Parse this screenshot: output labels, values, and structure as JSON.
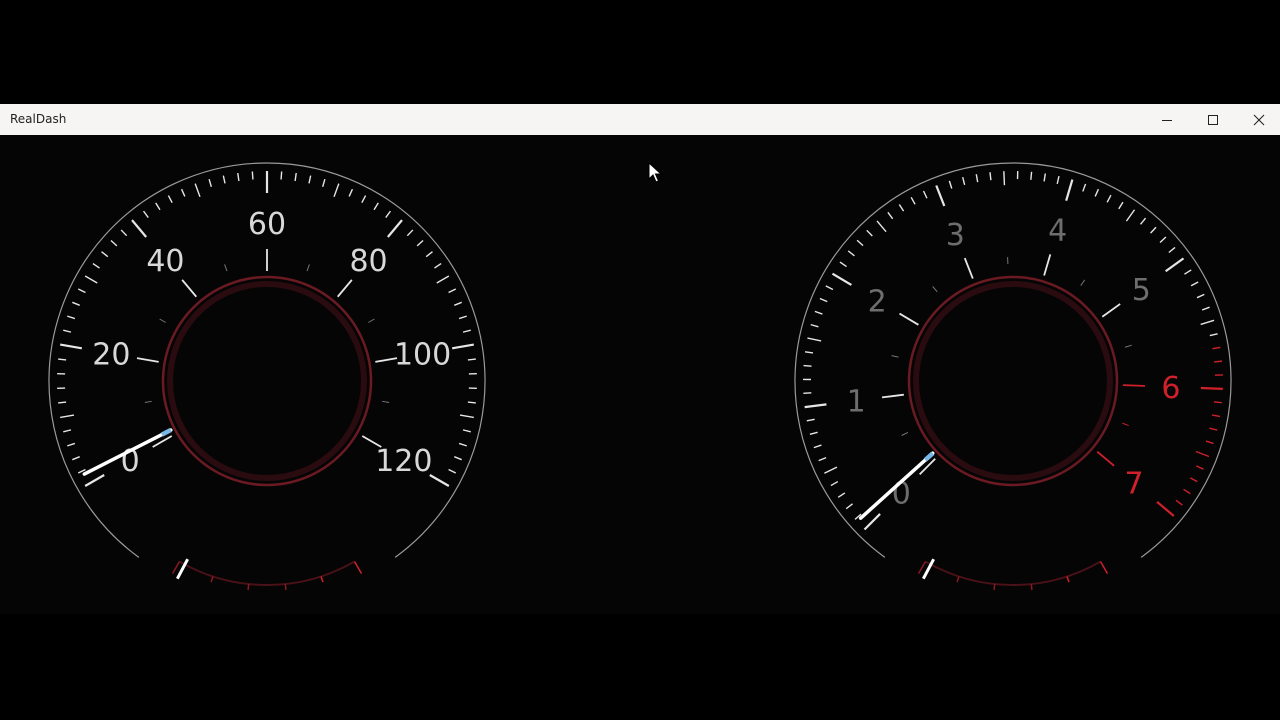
{
  "window": {
    "title": "RealDash",
    "controls": {
      "minimize": "minimize-icon",
      "maximize": "maximize-icon",
      "close": "close-icon"
    }
  },
  "colors": {
    "background": "#050505",
    "scale": "#e6e6e6",
    "dim_label": "#6e6e6e",
    "redline": "#d0202a",
    "needle_tip": "#7ab8e8",
    "hub_ring": "#6b1a22"
  },
  "speedometer": {
    "labels": [
      "0",
      "20",
      "40",
      "60",
      "80",
      "100",
      "120"
    ],
    "value": 0
  },
  "tachometer": {
    "labels": [
      "0",
      "1",
      "2",
      "3",
      "4",
      "5",
      "6",
      "7"
    ],
    "redline_from": 6,
    "value": 0
  }
}
